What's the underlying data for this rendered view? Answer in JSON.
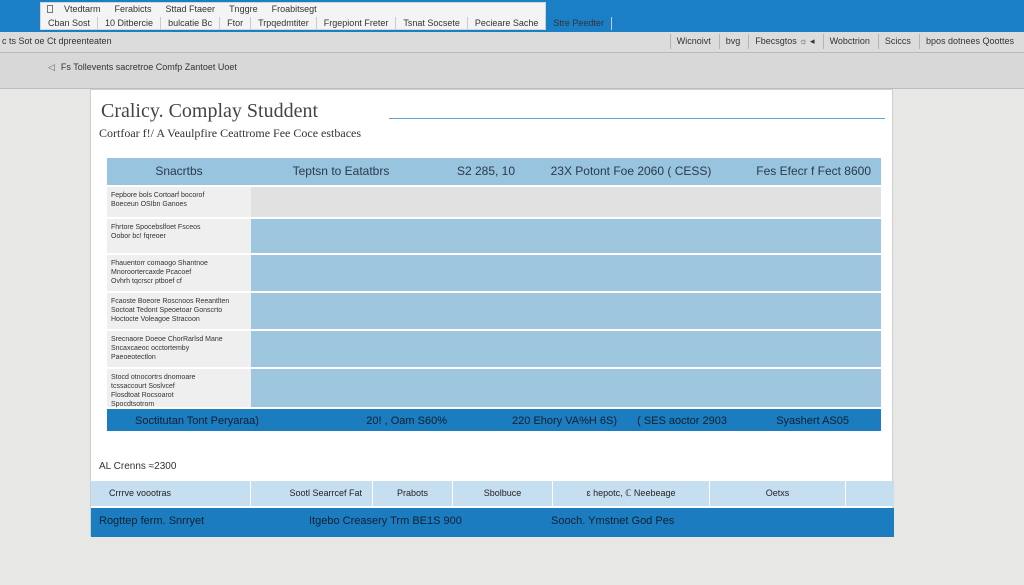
{
  "window": {
    "tabs_row1": [
      "Vtedtarm",
      "Ferabicts",
      "Sttad Ftaeer",
      "Tnggre",
      "Froabitsegt"
    ],
    "tabs_row2": [
      "Cban Sost",
      "10 Ditbercie",
      "bulcatie Bc",
      "Ftor",
      "Trpqedmtiter",
      "Frgepiont Freter",
      "Tsnat Socsete",
      "Pecieare Sache",
      "Stre Peedter"
    ]
  },
  "menu": {
    "left": "c ts Sot oe Ct dpreenteaten",
    "right": [
      "Wicnoivt",
      "bvg",
      "Fbecsgtos ☼ ◂",
      "Wobctrion",
      "Sciccs",
      "bpos dotnees Qoottes"
    ]
  },
  "breadcrumb": "Fs Tollevents sacretroe Comfp Zantoet Uoet",
  "document": {
    "title": "Cralicy. Complay  Studdent",
    "subtitle": "Cortfoar f!/ A Veaulpfire Ceattrome Fee Coce estbaces",
    "table": {
      "headers": [
        "Snacrtbs",
        "Teptsn to Eatatbrs",
        "S2 285, 10",
        "23X Potont Foe 2060 ( CESS)",
        "Fes Efecr f Fect 8600"
      ],
      "rows": [
        {
          "label_lines": [
            "Fepbore bols Cortoarf bocorof",
            "Boeceun OSIbn Ganoes"
          ]
        },
        {
          "label_lines": [
            "Fhrtore Spocebslfoet Fsceos",
            "Oobor bc! fqreoer"
          ]
        },
        {
          "label_lines": [
            "Fhauentorr comaogo Shantnoe",
            "Mnoroortercaxde Pcacoef",
            "Ovhrh tqcrscr ptboef cf"
          ]
        },
        {
          "label_lines": [
            "Fcaoste Boeore Roscnoos Reeantlten",
            "Soctoat Tedont Speoetoar Gonscrto",
            "Hoctocte Voleagoe Stracoon"
          ]
        },
        {
          "label_lines": [
            "Srecnaore Doeoe ChorRarlsd Mane",
            "Sncaxcaeoc occtortemby",
            "Paeoeotectlon"
          ]
        },
        {
          "label_lines": [
            "Stocd otnocortrs dnomoare",
            "tcssaccourt Soslvcef",
            "Flosdtoat Rocsoarot",
            "Spocdtsotrom"
          ]
        }
      ],
      "footer": [
        "Soctitutan Tont Peryaraa)",
        "20! , Oam S60%",
        "220 Ehory VA%H 6S)",
        "( SES aoctor 2903",
        "Syashert AS05"
      ]
    },
    "total": "AL Crenns ≈2300",
    "summary_cells": [
      "Crrrve voootras",
      "Sootl Searrcef Fat",
      "Prabots",
      "Sbolbuce",
      "ɛ hepotc, ℂ Neebeage",
      "Oetxs",
      ""
    ],
    "bottom": {
      "left": "Rogttep ferm. Snrryet",
      "middle": "Itgebo Creasery Trm BE1S 900",
      "right": "Sooch. Ymstnet  God Pes"
    }
  }
}
